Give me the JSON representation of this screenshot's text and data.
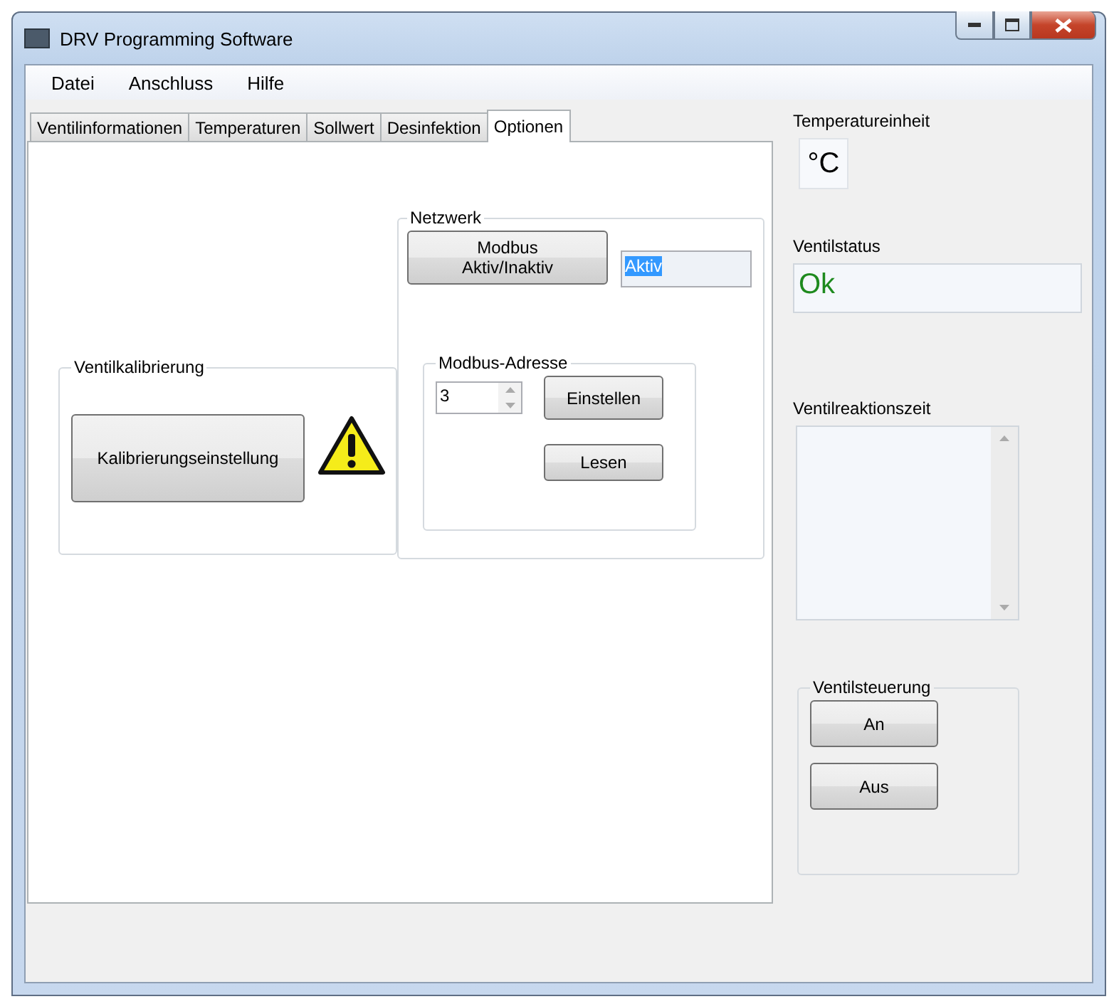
{
  "window": {
    "title": "DRV Programming Software"
  },
  "menu": [
    "Datei",
    "Anschluss",
    "Hilfe"
  ],
  "tabs": [
    {
      "label": "Ventilinformationen",
      "selected": false
    },
    {
      "label": "Temperaturen",
      "selected": false
    },
    {
      "label": "Sollwert",
      "selected": false
    },
    {
      "label": "Desinfektion",
      "selected": false
    },
    {
      "label": "Optionen",
      "selected": true
    }
  ],
  "calibration": {
    "title": "Ventilkalibrierung",
    "button": "Kalibrierungseinstellung"
  },
  "network": {
    "title": "Netzwerk",
    "toggle_button": "Modbus\nAktiv/Inaktiv",
    "status_field": {
      "value": "Aktiv",
      "highlighted": true
    },
    "address": {
      "title": "Modbus-Adresse",
      "value": "3",
      "buttons": [
        "Einstellen",
        "Lesen"
      ]
    }
  },
  "side": {
    "temperature_unit": {
      "label": "Temperatureinheit",
      "value": "°C"
    },
    "valve_status": {
      "label": "Ventilstatus",
      "value": "Ok"
    },
    "reaction_time": {
      "label": "Ventilreaktionszeit"
    },
    "valve_control": {
      "title": "Ventilsteuerung",
      "buttons": [
        "An",
        "Aus"
      ]
    }
  }
}
